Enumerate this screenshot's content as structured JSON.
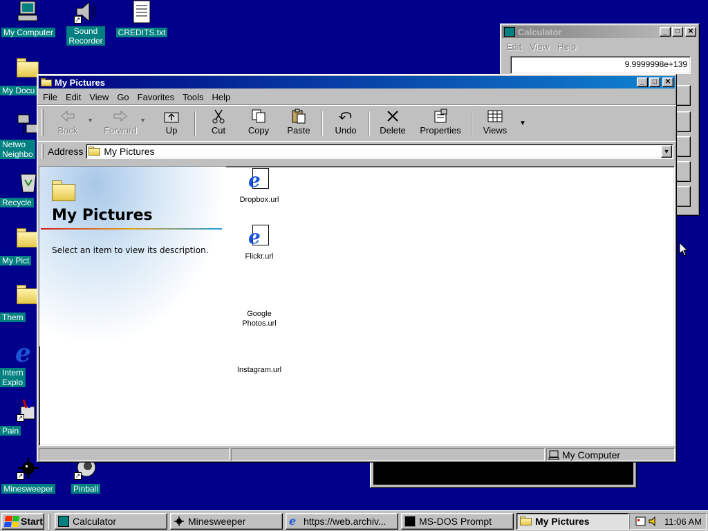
{
  "desktop": {
    "icons": [
      {
        "label": "My Computer"
      },
      {
        "label": "Sound\nRecorder"
      },
      {
        "label": "CREDITS.txt"
      },
      {
        "label": "My Docu"
      },
      {
        "label": "Netwo\nNeighbo"
      },
      {
        "label": "Recycle"
      },
      {
        "label": "My Pict"
      },
      {
        "label": "Them"
      },
      {
        "label": "Intern\nExplo"
      },
      {
        "label": "Pain"
      },
      {
        "label": "Minesweeper"
      },
      {
        "label": "Pinball"
      }
    ]
  },
  "calculator": {
    "title": "Calculator",
    "menu": [
      "Edit",
      "View",
      "Help"
    ],
    "display": "9.9999998e+139"
  },
  "explorer": {
    "title": "My Pictures",
    "menu": [
      "File",
      "Edit",
      "View",
      "Go",
      "Favorites",
      "Tools",
      "Help"
    ],
    "toolbar": {
      "back": "Back",
      "forward": "Forward",
      "up": "Up",
      "cut": "Cut",
      "copy": "Copy",
      "paste": "Paste",
      "undo": "Undo",
      "delete": "Delete",
      "properties": "Properties",
      "views": "Views"
    },
    "address_label": "Address",
    "address_value": "My Pictures",
    "webview": {
      "heading": "My Pictures",
      "description": "Select an item to view its description."
    },
    "files": [
      {
        "name": "Dropbox.url",
        "icon": "ie-url-icon"
      },
      {
        "name": "Flickr.url",
        "icon": "ie-url-icon"
      },
      {
        "name": "Google\nPhotos.url",
        "icon": "none"
      },
      {
        "name": "Instagram.url",
        "icon": "none"
      }
    ],
    "status": {
      "left": "",
      "middle": "",
      "zone": "My Computer"
    }
  },
  "taskbar": {
    "start": "Start",
    "items": [
      {
        "label": "Calculator"
      },
      {
        "label": "Minesweeper"
      },
      {
        "label": "https://web.archiv..."
      },
      {
        "label": "MS-DOS Prompt"
      },
      {
        "label": "My Pictures"
      }
    ],
    "clock": "11:06 AM"
  },
  "colors": {
    "desktop": "#00008b",
    "icon_label_bg": "#008080",
    "title_active_start": "#000080",
    "title_active_end": "#1084d0",
    "window_face": "#c0c0c0"
  }
}
